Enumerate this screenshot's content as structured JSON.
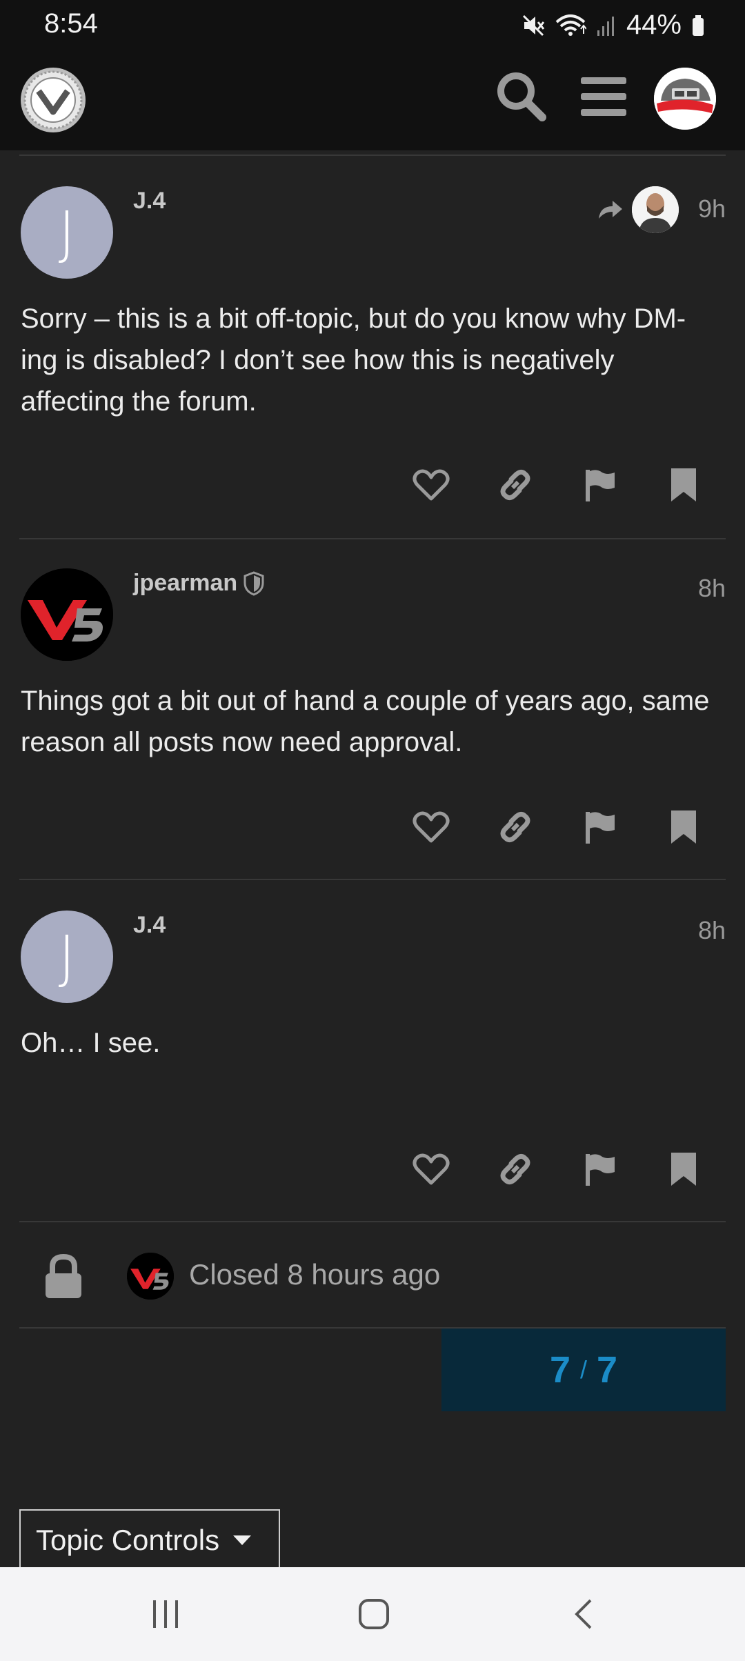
{
  "status_bar": {
    "time": "8:54",
    "battery": "44%",
    "icons": [
      "mute-icon",
      "wifi-icon",
      "signal-icon",
      "battery-icon"
    ]
  },
  "header": {
    "icons": [
      "site-logo",
      "search-icon",
      "hamburger-menu-icon",
      "user-avatar"
    ]
  },
  "posts": [
    {
      "username": "J.4",
      "avatar_letter": "J",
      "time": "9h",
      "body": "Sorry – this is a bit off-topic, but do you know why DM-ing is disabled? I don’t see how this is negatively affecting the forum.",
      "has_reply_to": true
    },
    {
      "username": "jpearman",
      "avatar_letter": "",
      "time": "8h",
      "body": "Things got a bit out of hand a couple of years ago, same reason all posts now need approval.",
      "moderator": true
    },
    {
      "username": "J.4",
      "avatar_letter": "J",
      "time": "8h",
      "body": "Oh… I see."
    }
  ],
  "actions": [
    "like-icon",
    "link-icon",
    "flag-icon",
    "bookmark-icon"
  ],
  "closed_notice": {
    "text": "Closed 8 hours ago"
  },
  "progress": {
    "current": "7",
    "separator": "/",
    "total": "7"
  },
  "topic_controls": {
    "label": "Topic Controls"
  },
  "colors": {
    "background": "#222222",
    "header": "#111111",
    "avatar_letter_bg": "#a9adc3",
    "progress_bg": "#08293a",
    "progress_text": "#1b8cc7",
    "v5_red": "#e0232b"
  }
}
